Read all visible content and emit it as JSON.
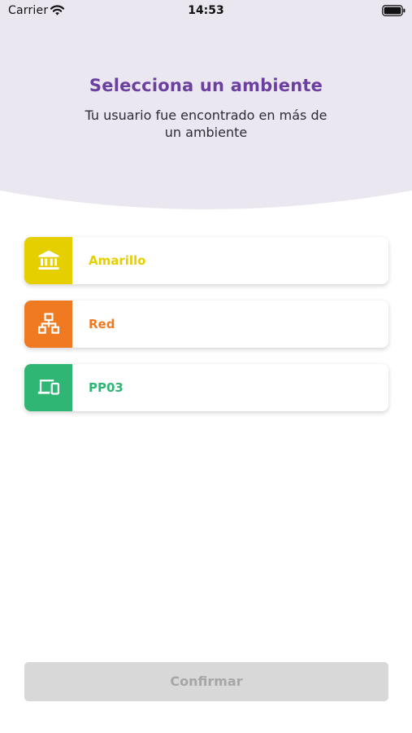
{
  "status_bar": {
    "carrier": "Carrier",
    "time": "14:53",
    "wifi_icon": "wifi-icon",
    "battery_icon": "battery-icon"
  },
  "header": {
    "title": "Selecciona un ambiente",
    "subtitle": "Tu usuario fue encontrado en más de un ambiente",
    "background_color": "#ebe7f0",
    "title_color": "#6b3fa0"
  },
  "environments": [
    {
      "label": "Amarillo",
      "icon": "bank-icon",
      "color": "#e5cf00"
    },
    {
      "label": "Red",
      "icon": "network-icon",
      "color": "#f07a22"
    },
    {
      "label": "PP03",
      "icon": "devices-icon",
      "color": "#2fb574"
    }
  ],
  "footer": {
    "confirm_label": "Confirmar",
    "confirm_bg": "#d8d8d8",
    "confirm_text_color": "#a6a6a6"
  }
}
